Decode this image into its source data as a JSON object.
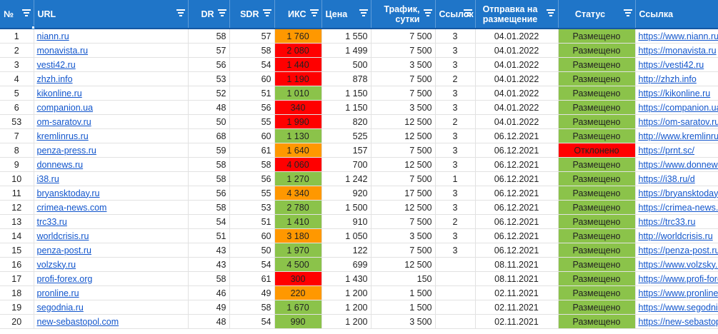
{
  "columns": [
    {
      "label": "№",
      "align": "left"
    },
    {
      "label": "URL",
      "align": "left"
    },
    {
      "label": "DR",
      "align": "right"
    },
    {
      "label": "SDR",
      "align": "right"
    },
    {
      "label": "ИКС",
      "align": "right"
    },
    {
      "label": "Цена",
      "align": "left"
    },
    {
      "label": "Трафик, сутки",
      "align": "right"
    },
    {
      "label": "Ссылок",
      "align": "left"
    },
    {
      "label": "Отправка на размещение",
      "align": "center"
    },
    {
      "label": "Статус",
      "align": "center"
    },
    {
      "label": "Ссылка",
      "align": "left"
    }
  ],
  "colors": {
    "header_bg": "#1f75c8",
    "iks_orange": "#ff9800",
    "iks_red": "#ff0000",
    "iks_green": "#8bc34a",
    "status_ok": "#8bc34a",
    "status_rejected": "#ff0000",
    "link": "#1155cc"
  },
  "rows": [
    {
      "n": "1",
      "url": "niann.ru",
      "dr": "58",
      "sdr": "57",
      "iks": "1 760",
      "iks_color": "orange",
      "price": "1 550",
      "traffic": "7 500",
      "links": "3",
      "date": "04.01.2022",
      "status": "Размещено",
      "status_color": "green",
      "link": "https://www.niann.ru"
    },
    {
      "n": "2",
      "url": "monavista.ru",
      "dr": "57",
      "sdr": "58",
      "iks": "2 080",
      "iks_color": "red",
      "price": "1 499",
      "traffic": "7 500",
      "links": "3",
      "date": "04.01.2022",
      "status": "Размещено",
      "status_color": "green",
      "link": "https://monavista.ru"
    },
    {
      "n": "3",
      "url": "vesti42.ru",
      "dr": "56",
      "sdr": "54",
      "iks": "1 440",
      "iks_color": "red",
      "price": "500",
      "traffic": "3 500",
      "links": "3",
      "date": "04.01.2022",
      "status": "Размещено",
      "status_color": "green",
      "link": "https://vesti42.ru"
    },
    {
      "n": "4",
      "url": "zhzh.info",
      "dr": "53",
      "sdr": "60",
      "iks": "1 190",
      "iks_color": "red",
      "price": "878",
      "traffic": "7 500",
      "links": "2",
      "date": "04.01.2022",
      "status": "Размещено",
      "status_color": "green",
      "link": "http://zhzh.info"
    },
    {
      "n": "5",
      "url": "kikonline.ru",
      "dr": "52",
      "sdr": "51",
      "iks": "1 010",
      "iks_color": "green",
      "price": "1 150",
      "traffic": "7 500",
      "links": "3",
      "date": "04.01.2022",
      "status": "Размещено",
      "status_color": "green",
      "link": "https://kikonline.ru"
    },
    {
      "n": "6",
      "url": "companion.ua",
      "dr": "48",
      "sdr": "56",
      "iks": "340",
      "iks_color": "red",
      "price": "1 150",
      "traffic": "3 500",
      "links": "3",
      "date": "04.01.2022",
      "status": "Размещено",
      "status_color": "green",
      "link": "https://companion.ua"
    },
    {
      "n": "53",
      "url": "om-saratov.ru",
      "dr": "50",
      "sdr": "55",
      "iks": "1 990",
      "iks_color": "red",
      "price": "820",
      "traffic": "12 500",
      "links": "2",
      "date": "04.01.2022",
      "status": "Размещено",
      "status_color": "green",
      "link": "https://om-saratov.ru"
    },
    {
      "n": "7",
      "url": "kremlinrus.ru",
      "dr": "68",
      "sdr": "60",
      "iks": "1 130",
      "iks_color": "green",
      "price": "525",
      "traffic": "12 500",
      "links": "3",
      "date": "06.12.2021",
      "status": "Размещено",
      "status_color": "green",
      "link": "http://www.kremlinrus.ru"
    },
    {
      "n": "8",
      "url": "penza-press.ru",
      "dr": "59",
      "sdr": "61",
      "iks": "1 640",
      "iks_color": "orange",
      "price": "157",
      "traffic": "7 500",
      "links": "3",
      "date": "06.12.2021",
      "status": "Отклонено",
      "status_color": "red",
      "link": "https://prnt.sc/"
    },
    {
      "n": "9",
      "url": "donnews.ru",
      "dr": "58",
      "sdr": "58",
      "iks": "4 060",
      "iks_color": "red",
      "price": "700",
      "traffic": "12 500",
      "links": "3",
      "date": "06.12.2021",
      "status": "Размещено",
      "status_color": "green",
      "link": "https://www.donnews.ru"
    },
    {
      "n": "10",
      "url": "i38.ru",
      "dr": "58",
      "sdr": "56",
      "iks": "1 270",
      "iks_color": "green",
      "price": "1 242",
      "traffic": "7 500",
      "links": "1",
      "date": "06.12.2021",
      "status": "Размещено",
      "status_color": "green",
      "link": "https://i38.ru/d"
    },
    {
      "n": "11",
      "url": "bryansktoday.ru",
      "dr": "56",
      "sdr": "55",
      "iks": "4 340",
      "iks_color": "orange",
      "price": "920",
      "traffic": "17 500",
      "links": "3",
      "date": "06.12.2021",
      "status": "Размещено",
      "status_color": "green",
      "link": "https://bryansktoday.ru"
    },
    {
      "n": "12",
      "url": "crimea-news.com",
      "dr": "58",
      "sdr": "53",
      "iks": "2 780",
      "iks_color": "green",
      "price": "1 500",
      "traffic": "12 500",
      "links": "3",
      "date": "06.12.2021",
      "status": "Размещено",
      "status_color": "green",
      "link": "https://crimea-news.com"
    },
    {
      "n": "13",
      "url": "trc33.ru",
      "dr": "54",
      "sdr": "51",
      "iks": "1 410",
      "iks_color": "green",
      "price": "910",
      "traffic": "7 500",
      "links": "2",
      "date": "06.12.2021",
      "status": "Размещено",
      "status_color": "green",
      "link": "https://trc33.ru"
    },
    {
      "n": "14",
      "url": "worldcrisis.ru",
      "dr": "51",
      "sdr": "60",
      "iks": "3 180",
      "iks_color": "orange",
      "price": "1 050",
      "traffic": "3 500",
      "links": "3",
      "date": "06.12.2021",
      "status": "Размещено",
      "status_color": "green",
      "link": "http://worldcrisis.ru"
    },
    {
      "n": "15",
      "url": "penza-post.ru",
      "dr": "43",
      "sdr": "50",
      "iks": "1 970",
      "iks_color": "green",
      "price": "122",
      "traffic": "7 500",
      "links": "3",
      "date": "06.12.2021",
      "status": "Размещено",
      "status_color": "green",
      "link": "https://penza-post.ru"
    },
    {
      "n": "16",
      "url": "volzsky.ru",
      "dr": "43",
      "sdr": "54",
      "iks": "4 500",
      "iks_color": "green",
      "price": "699",
      "traffic": "12 500",
      "links": "",
      "date": "08.11.2021",
      "status": "Размещено",
      "status_color": "green",
      "link": "https://www.volzsky.ru"
    },
    {
      "n": "17",
      "url": "profi-forex.org",
      "dr": "58",
      "sdr": "61",
      "iks": "300",
      "iks_color": "red",
      "price": "1 430",
      "traffic": "150",
      "links": "",
      "date": "08.11.2021",
      "status": "Размещено",
      "status_color": "green",
      "link": "https://www.profi-forex.org"
    },
    {
      "n": "18",
      "url": "pronline.ru",
      "dr": "46",
      "sdr": "49",
      "iks": "220",
      "iks_color": "orange",
      "price": "1 200",
      "traffic": "1 500",
      "links": "",
      "date": "02.11.2021",
      "status": "Размещено",
      "status_color": "green",
      "link": "https://www.pronline.ru"
    },
    {
      "n": "19",
      "url": "segodnia.ru",
      "dr": "49",
      "sdr": "58",
      "iks": "1 670",
      "iks_color": "green",
      "price": "1 200",
      "traffic": "1 500",
      "links": "",
      "date": "02.11.2021",
      "status": "Размещено",
      "status_color": "green",
      "link": "https://www.segodnia.ru"
    },
    {
      "n": "20",
      "url": "new-sebastopol.com",
      "dr": "48",
      "sdr": "54",
      "iks": "990",
      "iks_color": "green",
      "price": "1 200",
      "traffic": "3 500",
      "links": "",
      "date": "02.11.2021",
      "status": "Размещено",
      "status_color": "green",
      "link": "https://new-sebastopol.com"
    }
  ]
}
